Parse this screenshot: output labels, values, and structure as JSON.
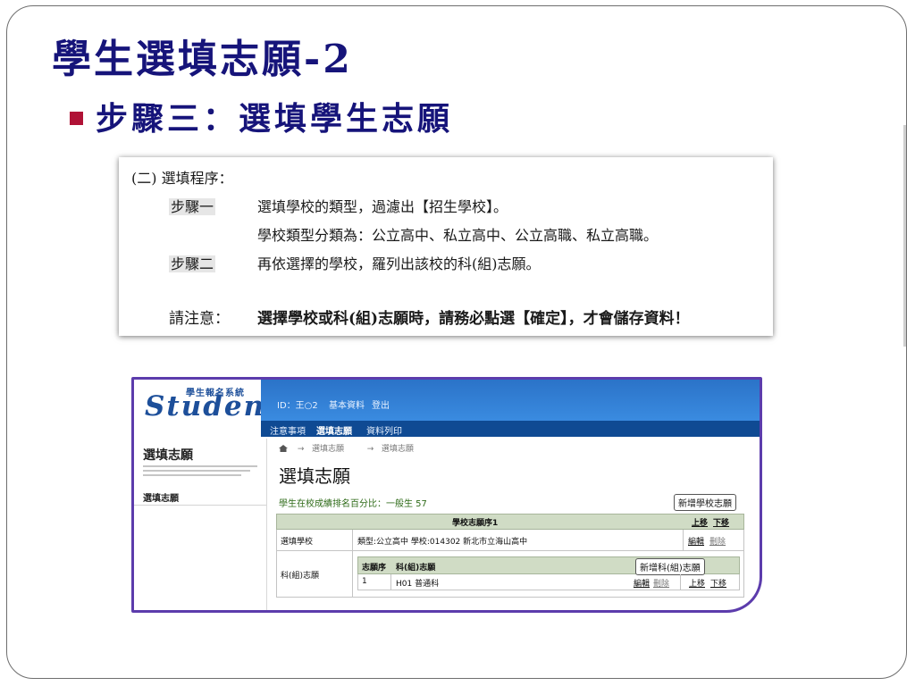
{
  "slide": {
    "title": "學生選填志願-2",
    "bullet": "步驟三：選填學生志願"
  },
  "procedure": {
    "heading": "(二) 選填程序：",
    "step1_tag": "步驟一",
    "step1_text": "選填學校的類型，過濾出【招生學校】。",
    "step1_detail": "學校類型分類為：公立高中、私立高中、公立高職、私立高職。",
    "step2_tag": "步驟二",
    "step2_text": "再依選擇的學校，羅列出該校的科(組)志願。",
    "notice_label": "請注意：",
    "notice_text": "選擇學校或科(組)志願時，請務必點選【確定】，才會儲存資料！"
  },
  "app": {
    "logo_sub": "學生報名系統",
    "logo_main": "Student",
    "nav_top": [
      "ID：王○2",
      "基本資料",
      "登出"
    ],
    "nav_bottom": [
      "注意事項",
      "選填志願",
      "資料列印"
    ],
    "sidebar_title": "選填志願",
    "sidebar_item": "選填志願",
    "breadcrumb": [
      "選填志願",
      "選填志願"
    ],
    "page_heading": "選填志願",
    "percentile": "學生在校成績排名百分比：一般生 57",
    "add_school_btn": "新增學校志願",
    "table_title": "學校志願序1",
    "move_up": "上移",
    "move_down": "下移",
    "row_school_label": "選填學校",
    "row_school_value": "類型:公立高中  學校:014302 新北市立海山高中",
    "edit": "編輯",
    "delete": "刪除",
    "row_dept_label": "科(組)志願",
    "dept_col_order": "志願序",
    "dept_col_name": "科(組)志願",
    "add_dept_btn": "新增科(組)志願",
    "dept_order": "1",
    "dept_name": "H01 普通科"
  },
  "colors": {
    "title": "#16147a",
    "bullet": "#b01236",
    "frame_border": "#5c3cac",
    "nav_blue": "#2b73c8",
    "table_header": "#d0dcc5"
  }
}
